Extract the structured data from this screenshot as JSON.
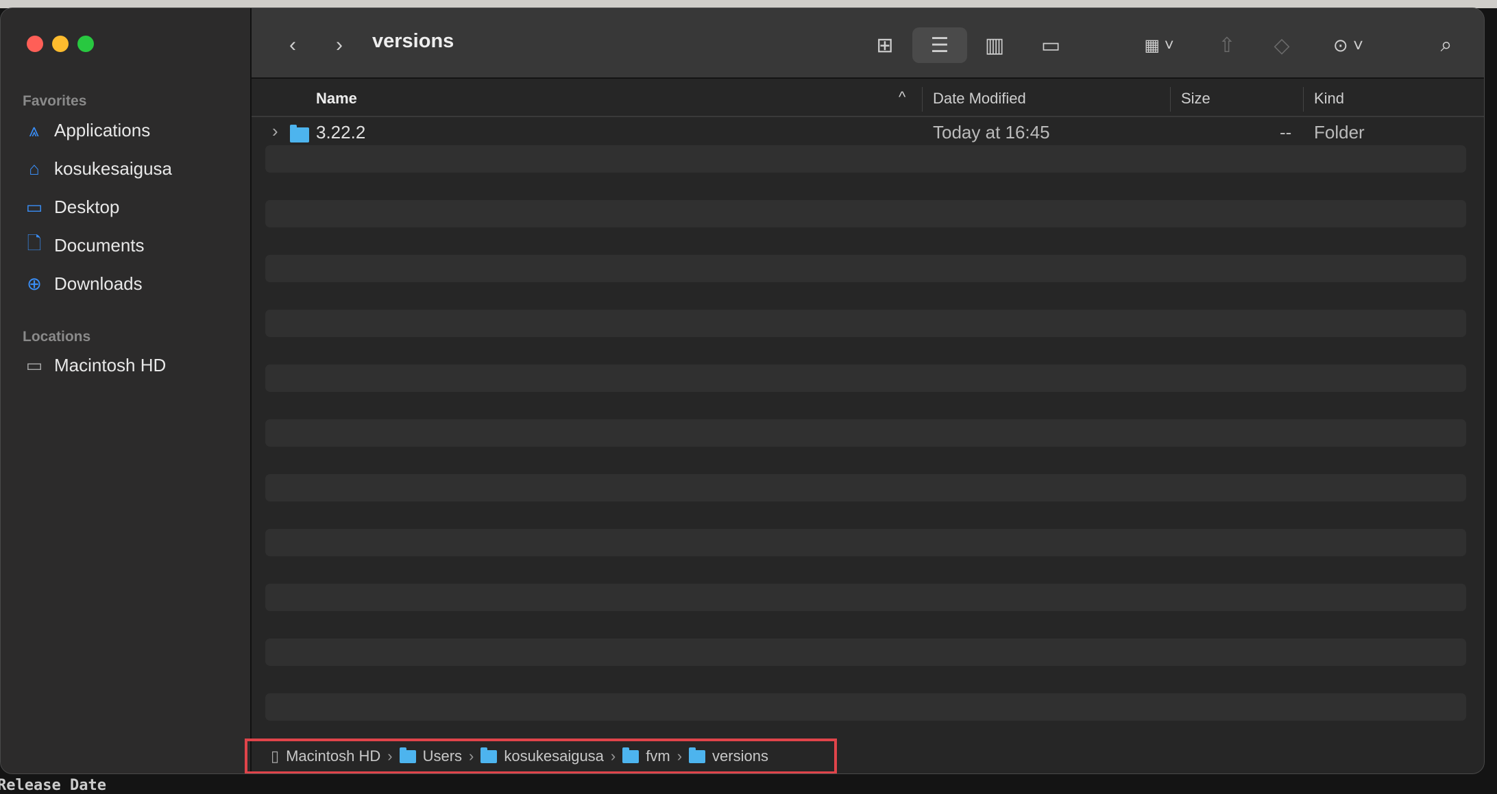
{
  "window": {
    "title": "versions"
  },
  "sidebar": {
    "favorites_label": "Favorites",
    "favorites": [
      {
        "label": "Applications",
        "icon": "applications-icon"
      },
      {
        "label": "kosukesaigusa",
        "icon": "home-icon"
      },
      {
        "label": "Desktop",
        "icon": "desktop-icon"
      },
      {
        "label": "Documents",
        "icon": "document-icon"
      },
      {
        "label": "Downloads",
        "icon": "download-icon"
      }
    ],
    "locations_label": "Locations",
    "locations": [
      {
        "label": "Macintosh HD",
        "icon": "disk-icon"
      }
    ]
  },
  "columns": {
    "name": "Name",
    "date": "Date Modified",
    "size": "Size",
    "kind": "Kind"
  },
  "files": [
    {
      "name": "3.22.2",
      "date": "Today at 16:45",
      "size": "--",
      "kind": "Folder"
    }
  ],
  "pathbar": [
    "Macintosh HD",
    "Users",
    "kosukesaigusa",
    "fvm",
    "versions"
  ],
  "background_text": "Release Date",
  "colors": {
    "accent": "#3a8ef6",
    "folder": "#4db4ee",
    "highlight_box": "#e0444a"
  }
}
